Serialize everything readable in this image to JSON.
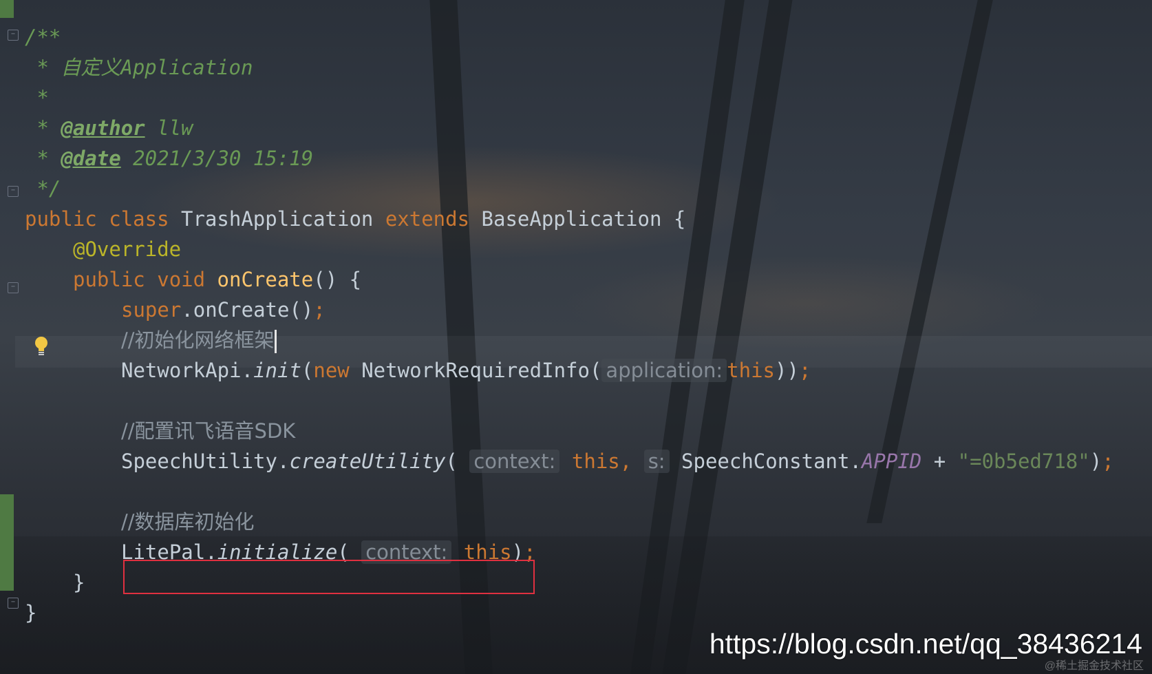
{
  "code": {
    "doc_open": "/**",
    "doc_line_title": " * 自定义Application",
    "doc_blank": " *",
    "doc_author_prefix": " * ",
    "doc_author_tag": "@author",
    "doc_author_value": " llw",
    "doc_date_prefix": " * ",
    "doc_date_tag": "@date",
    "doc_date_value": " 2021/3/30 15:19",
    "doc_close": " */",
    "class_public": "public",
    "class_class": "class",
    "class_name": "TrashApplication",
    "class_extends": "extends",
    "class_parent": "BaseApplication {",
    "override": "@Override",
    "method_public": "public",
    "method_void": "void",
    "method_name": "onCreate",
    "method_rest": "() {",
    "super_kw": "super",
    "super_call": ".onCreate()",
    "semicolon": ";",
    "comment_network": "//初始化网络框架",
    "net_obj": "NetworkApi.",
    "net_method": "init",
    "net_open": "(",
    "net_new": "new",
    "net_class": " NetworkRequiredInfo(",
    "net_hint": "application:",
    "net_this": "this",
    "net_close": "))",
    "comment_speech": "//配置讯飞语音SDK",
    "speech_obj": "SpeechUtility.",
    "speech_method": "createUtility",
    "speech_open": "(",
    "speech_hint1": "context:",
    "speech_this": "this,",
    "speech_hint2": "s:",
    "speech_const_obj": "SpeechConstant.",
    "speech_const": "APPID",
    "speech_plus": " + ",
    "speech_str": "\"=0b5ed718\"",
    "speech_close": ")",
    "comment_db": "//数据库初始化",
    "lite_obj": "LitePal.",
    "lite_method": "initialize",
    "lite_open": "(",
    "lite_hint": "context:",
    "lite_this": "this",
    "lite_close": ")",
    "method_close": "}",
    "class_close": "}"
  },
  "colors": {
    "keyword": "#cc7832",
    "comment": "#6a9a55",
    "function": "#ffc66d",
    "annotation": "#bbb529",
    "constant": "#9876aa",
    "highlight_box": "#e03040"
  },
  "icons": {
    "gutter_bulb": "lightbulb-icon",
    "fold_marker": "fold-icon"
  },
  "watermark": {
    "url": "https://blog.csdn.net/qq_38436214",
    "faint": "@稀土掘金技术社区"
  }
}
